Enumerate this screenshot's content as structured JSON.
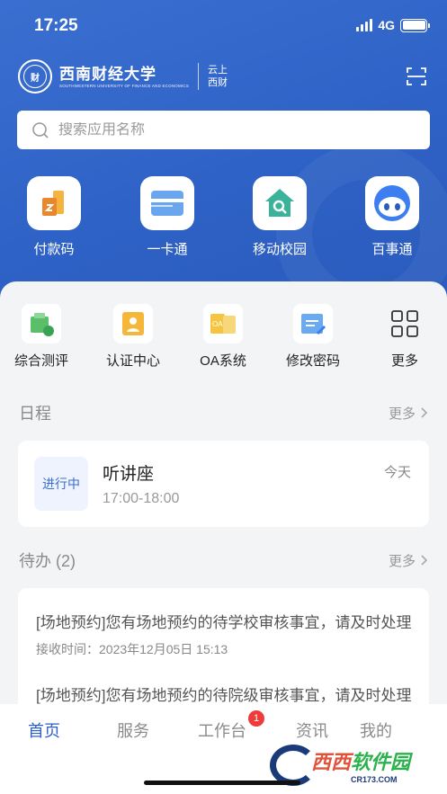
{
  "colors": {
    "primary": "#2f62c6",
    "badge": "#ee3b3b"
  },
  "status_bar": {
    "time": "17:25",
    "network": "4G"
  },
  "header": {
    "school_name_cn": "西南财经大学",
    "school_name_en": "SOUTHWESTERN UNIVERSITY OF FINANCE AND ECONOMICS",
    "app_name_line1": "云上",
    "app_name_line2": "西财"
  },
  "search": {
    "placeholder": "搜索应用名称"
  },
  "quick_actions": [
    {
      "label": "付款码",
      "icon": "payment-code-icon"
    },
    {
      "label": "一卡通",
      "icon": "campus-card-icon"
    },
    {
      "label": "移动校园",
      "icon": "mobile-campus-icon"
    },
    {
      "label": "百事通",
      "icon": "robot-assistant-icon"
    }
  ],
  "services": [
    {
      "label": "综合测评",
      "icon": "evaluation-icon"
    },
    {
      "label": "认证中心",
      "icon": "auth-center-icon"
    },
    {
      "label": "OA系统",
      "icon": "oa-system-icon"
    },
    {
      "label": "修改密码",
      "icon": "change-password-icon"
    },
    {
      "label": "更多",
      "icon": "grid-more-icon"
    }
  ],
  "schedule": {
    "title": "日程",
    "more": "更多",
    "item": {
      "status": "进行中",
      "title": "听讲座",
      "time": "17:00-18:00",
      "day": "今天"
    }
  },
  "todo": {
    "title": "待办 (2)",
    "more": "更多",
    "items": [
      {
        "title": "[场地预约]您有场地预约的待学校审核事宜，请及时处理",
        "received": "接收时间：2023年12月05日 15:13"
      },
      {
        "title": "[场地预约]您有场地预约的待院级审核事宜，请及时处理"
      }
    ]
  },
  "tabbar": {
    "items": [
      "首页",
      "服务",
      "工作台",
      "资讯",
      "我的"
    ],
    "active": "首页",
    "workbench_badge": "1"
  },
  "watermark": {
    "text_a": "西西",
    "text_b": "软件园",
    "url": "CR173.COM"
  }
}
